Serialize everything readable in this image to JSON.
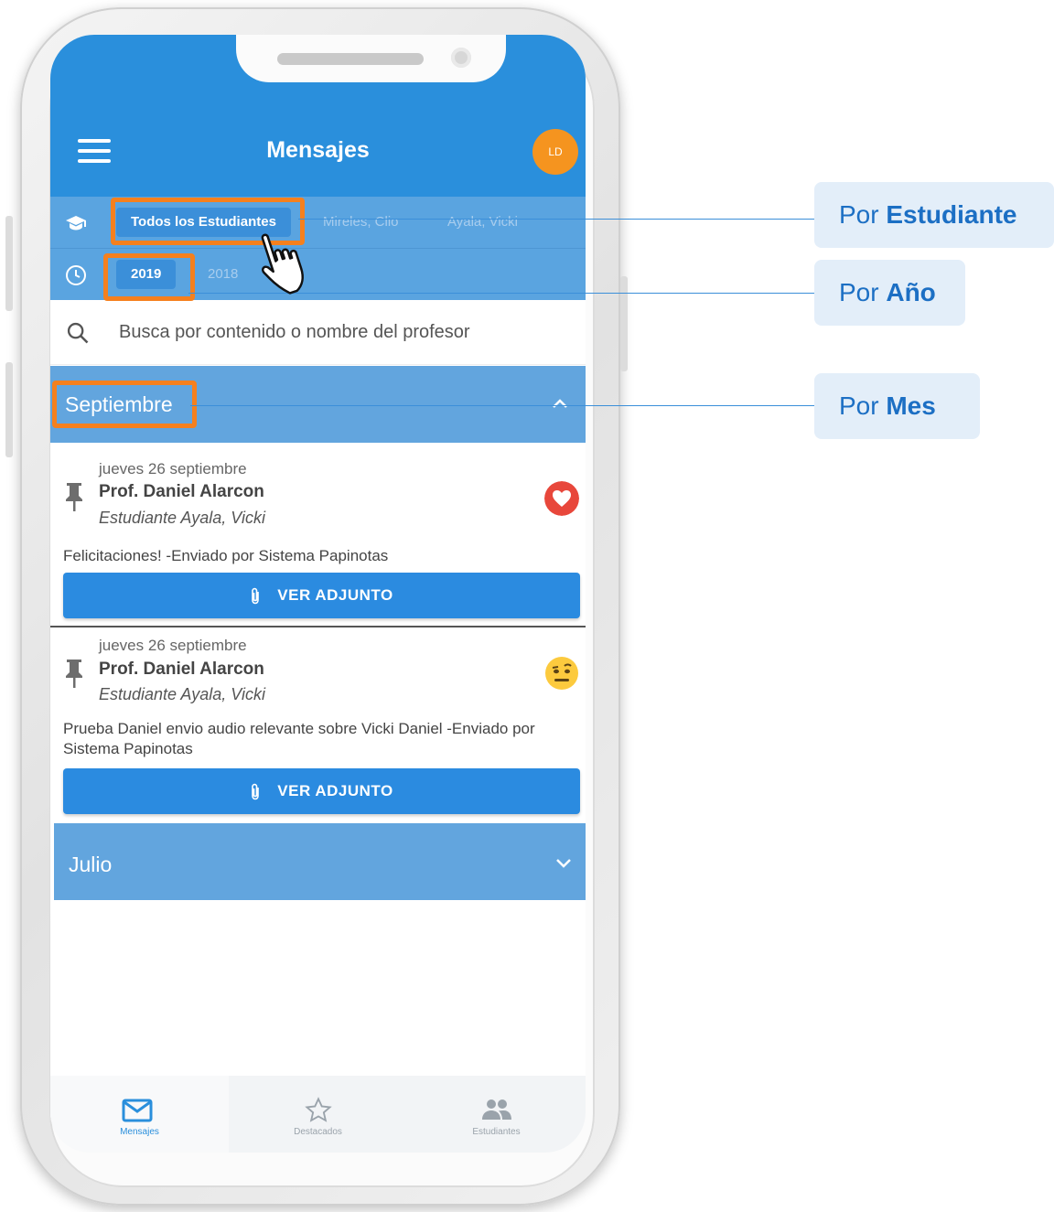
{
  "app": {
    "title": "Mensajes",
    "avatar_initials": "LD",
    "colors": {
      "primary": "#2a8fdc",
      "accent_orange": "#f5941f",
      "highlight": "#f5801e"
    }
  },
  "filters": {
    "students": {
      "selected": "Todos los Estudiantes",
      "options": [
        "Mireles, Clio",
        "Ayala, Vicki"
      ]
    },
    "years": {
      "selected": "2019",
      "options": [
        "2018"
      ]
    }
  },
  "search": {
    "placeholder": "Busca por contenido o nombre del profesor"
  },
  "months": [
    {
      "label": "Septiembre",
      "expanded": true,
      "messages": [
        {
          "date": "jueves 26 septiembre",
          "teacher": "Prof. Daniel Alarcon",
          "student": "Estudiante Ayala, Vicki",
          "body": "Felicitaciones!   -Enviado por Sistema Papinotas",
          "reaction_icon": "heart-icon",
          "attachment_label": "VER ADJUNTO"
        },
        {
          "date": "jueves 26 septiembre",
          "teacher": "Prof. Daniel Alarcon",
          "student": "Estudiante Ayala, Vicki",
          "body": "Prueba Daniel envio audio relevante sobre Vicki Daniel   -Enviado por Sistema Papinotas",
          "reaction_icon": "skeptical-emoji-icon",
          "attachment_label": "VER ADJUNTO"
        }
      ]
    },
    {
      "label": "Julio",
      "expanded": false
    }
  ],
  "bottom_nav": [
    {
      "label": "Mensajes",
      "icon": "envelope-icon",
      "active": true
    },
    {
      "label": "Destacados",
      "icon": "star-icon",
      "active": false
    },
    {
      "label": "Estudiantes",
      "icon": "people-icon",
      "active": false
    }
  ],
  "callouts": [
    {
      "prefix": "Por",
      "bold": "Estudiante"
    },
    {
      "prefix": "Por",
      "bold": "Año"
    },
    {
      "prefix": "Por",
      "bold": "Mes"
    }
  ]
}
